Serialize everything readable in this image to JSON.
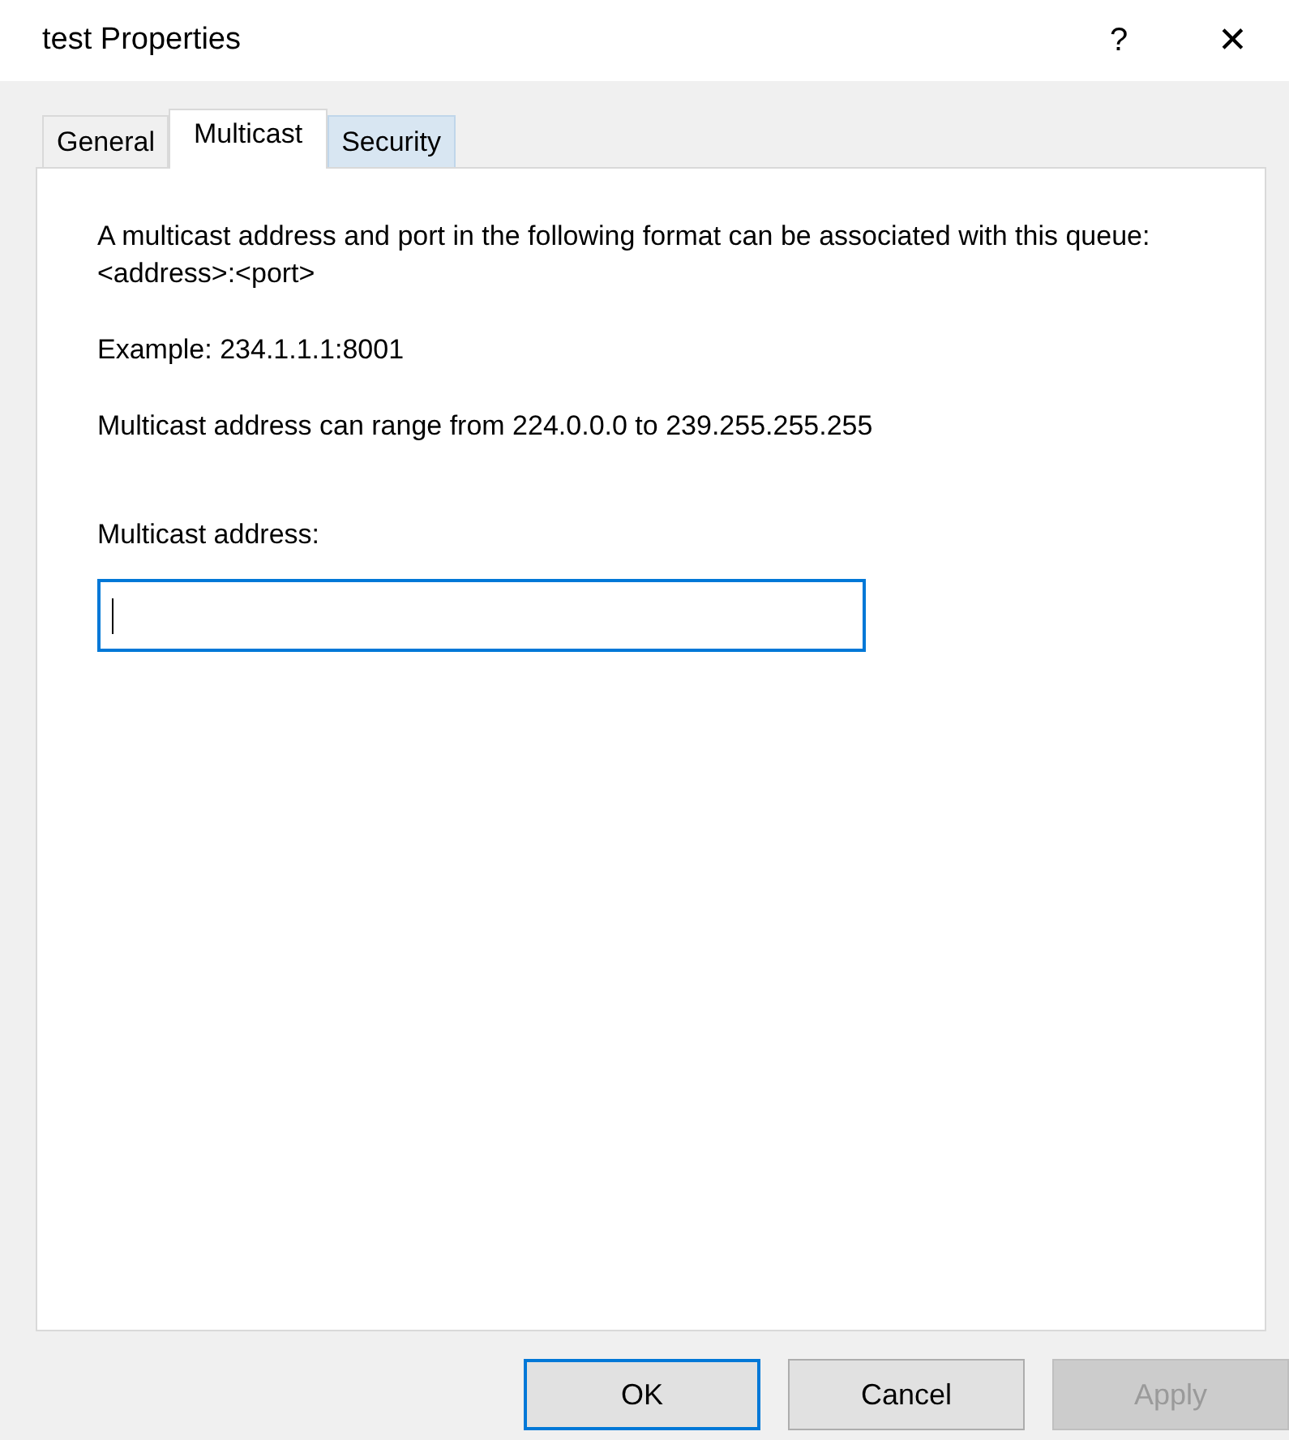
{
  "window": {
    "title": "test Properties",
    "help": "?",
    "close": "✕"
  },
  "tabs": [
    {
      "label": "General",
      "selected": false,
      "hovered": false
    },
    {
      "label": "Multicast",
      "selected": true,
      "hovered": false
    },
    {
      "label": "Security",
      "selected": false,
      "hovered": true
    }
  ],
  "paragraphs": [
    "A multicast address and port in the following format can be associated with this queue: <address>:<port>",
    "Example: 234.1.1.1:8001",
    "Multicast address can range from 224.0.0.0 to 239.255.255.255"
  ],
  "field": {
    "label": "Multicast address:",
    "focused": true
  },
  "buttons": [
    {
      "label": "OK",
      "default": true,
      "disabled": false
    },
    {
      "label": "Cancel",
      "default": false,
      "disabled": false
    },
    {
      "label": "Apply",
      "default": false,
      "disabled": true
    }
  ]
}
